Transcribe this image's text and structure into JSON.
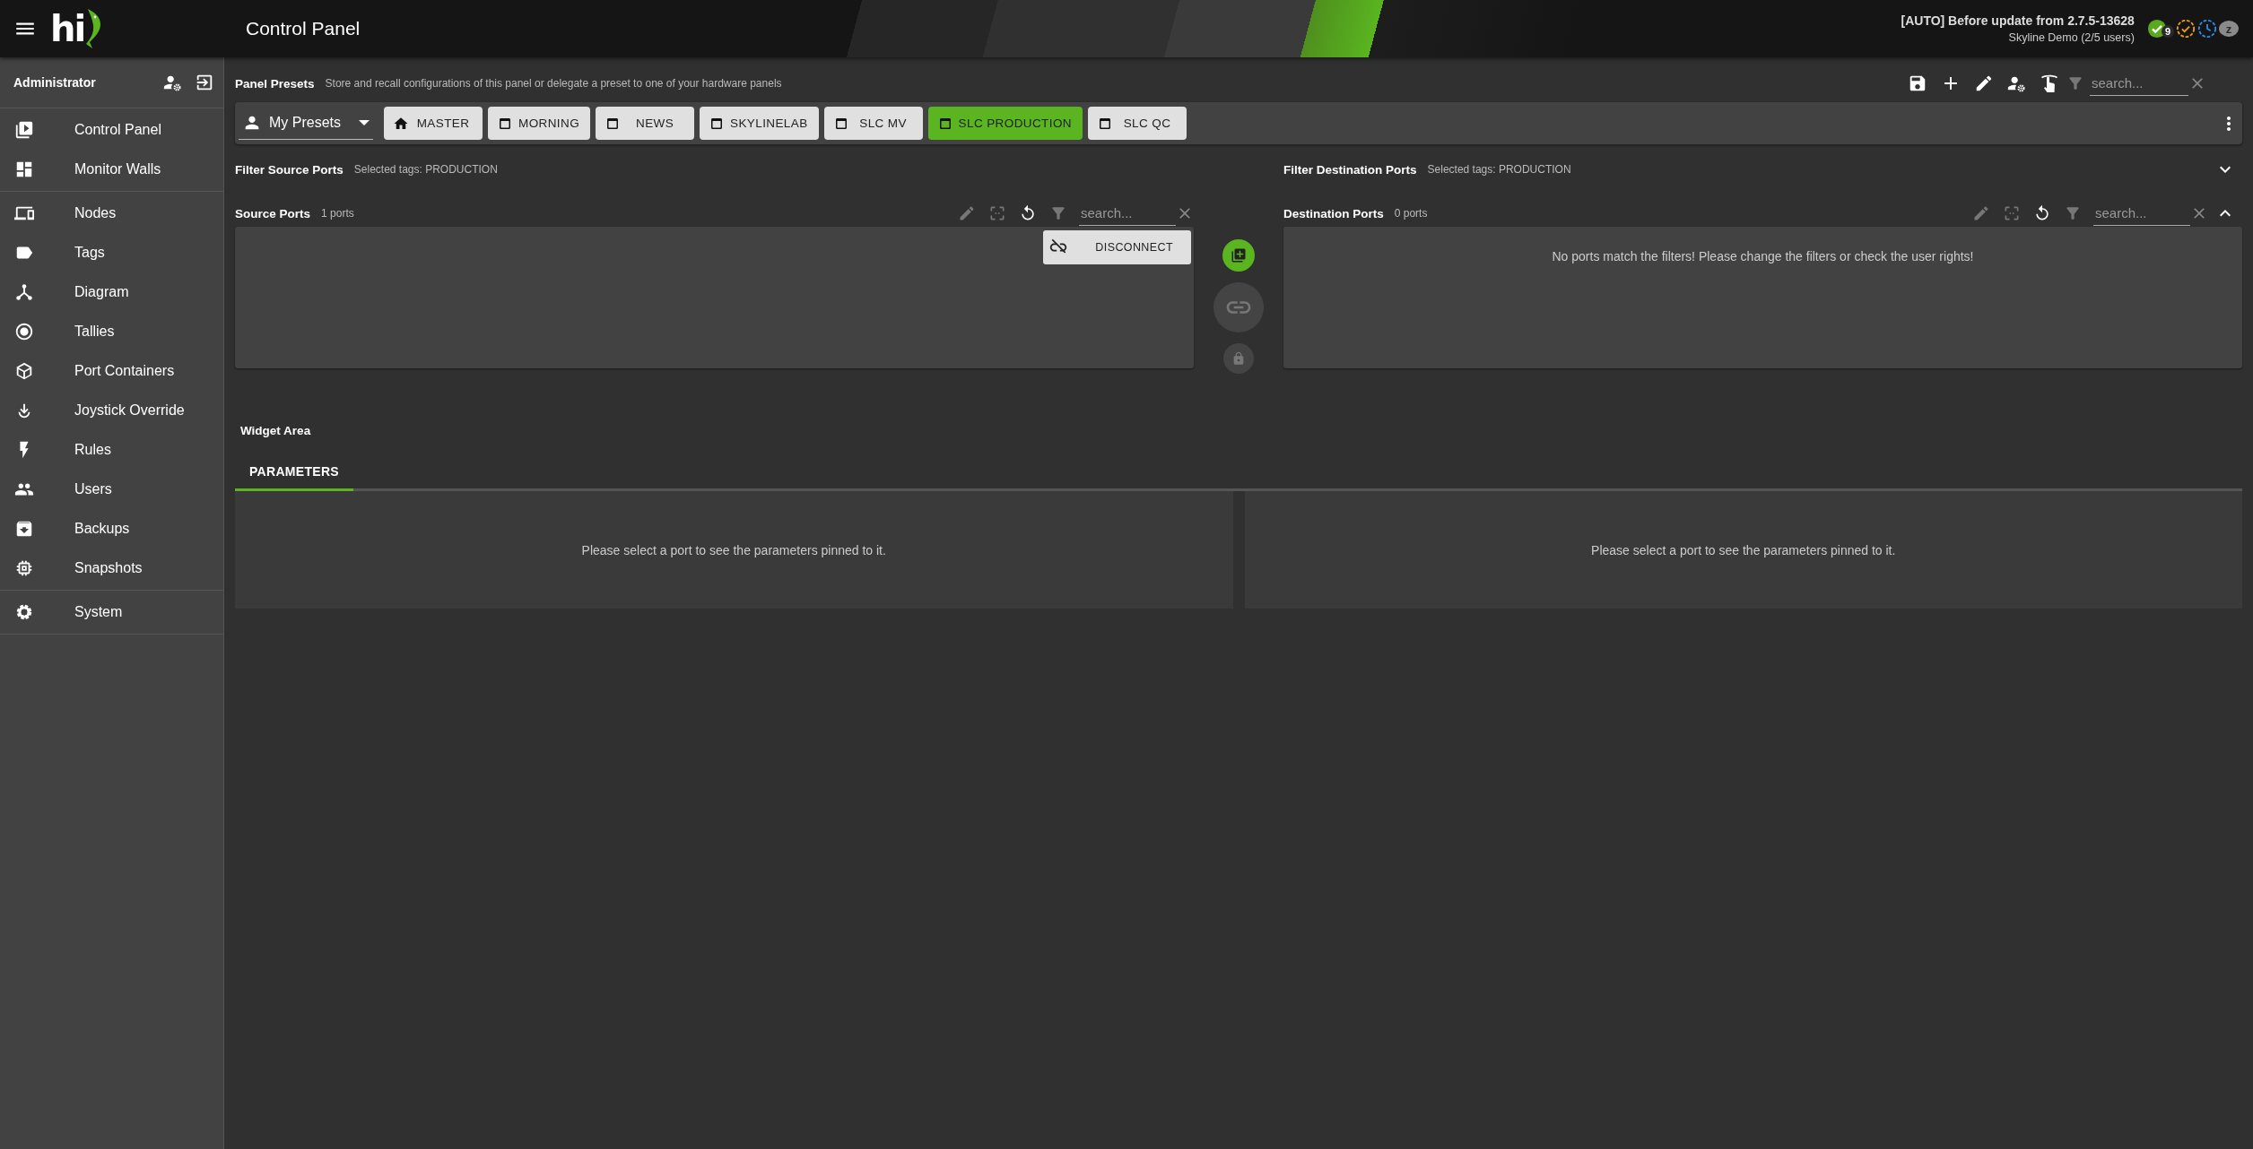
{
  "header": {
    "logo": "hi",
    "title": "Control Panel",
    "snapshot": "[AUTO] Before update from 2.7.5-13628",
    "system": "Skyline Demo (2/5 users)",
    "status": [
      {
        "kind": "ok",
        "badge": "9"
      },
      {
        "kind": "pending"
      },
      {
        "kind": "scheduled"
      },
      {
        "kind": "sleep",
        "label": "z"
      }
    ]
  },
  "sidebar": {
    "user": "Administrator",
    "sections": [
      {
        "items": [
          {
            "label": "Control Panel"
          },
          {
            "label": "Monitor Walls"
          }
        ]
      },
      {
        "items": [
          {
            "label": "Nodes"
          },
          {
            "label": "Tags"
          },
          {
            "label": "Diagram"
          },
          {
            "label": "Tallies"
          },
          {
            "label": "Port Containers"
          },
          {
            "label": "Joystick Override"
          },
          {
            "label": "Rules"
          },
          {
            "label": "Users"
          },
          {
            "label": "Backups"
          },
          {
            "label": "Snapshots"
          }
        ]
      },
      {
        "items": [
          {
            "label": "System"
          }
        ]
      }
    ]
  },
  "presets": {
    "title": "Panel Presets",
    "description": "Store and recall configurations of this panel or delegate a preset to one of your hardware panels",
    "search": {
      "placeholder": "search..."
    },
    "owner": "My Presets",
    "items": [
      {
        "label": "MASTER",
        "kind": "home",
        "selected": false
      },
      {
        "label": "MORNING",
        "kind": "window",
        "selected": false
      },
      {
        "label": "NEWS",
        "kind": "window",
        "selected": false
      },
      {
        "label": "SKYLINELAB",
        "kind": "window",
        "selected": false
      },
      {
        "label": "SLC MV",
        "kind": "window",
        "selected": false
      },
      {
        "label": "SLC PRODUCTION",
        "kind": "window",
        "selected": true
      },
      {
        "label": "SLC QC",
        "kind": "window",
        "selected": false
      }
    ]
  },
  "source_filter": {
    "title": "Filter Source Ports",
    "tags": "Selected tags: PRODUCTION"
  },
  "destination_filter": {
    "title": "Filter Destination Ports",
    "tags": "Selected tags: PRODUCTION",
    "expanded": false
  },
  "source_ports": {
    "title": "Source Ports",
    "count": "1 ports",
    "search": {
      "placeholder": "search..."
    },
    "tools": [
      {
        "disabled": true
      },
      {
        "disabled": true
      },
      {
        "disabled": false
      },
      {
        "disabled": true
      }
    ],
    "action": "DISCONNECT"
  },
  "destination_ports": {
    "title": "Destination Ports",
    "count": "0 ports",
    "search": {
      "placeholder": "search..."
    },
    "tools": [
      {
        "disabled": true
      },
      {
        "disabled": true
      },
      {
        "disabled": false
      },
      {
        "disabled": true
      }
    ],
    "empty": "No ports match the filters! Please change the filters or check the user rights!"
  },
  "widget_area": {
    "title": "Widget Area",
    "tabs": [
      {
        "label": "PARAMETERS",
        "selected": true
      }
    ],
    "panels": [
      {
        "message": "Please select a port to see the parameters pinned to it."
      },
      {
        "message": "Please select a port to see the parameters pinned to it."
      }
    ]
  }
}
